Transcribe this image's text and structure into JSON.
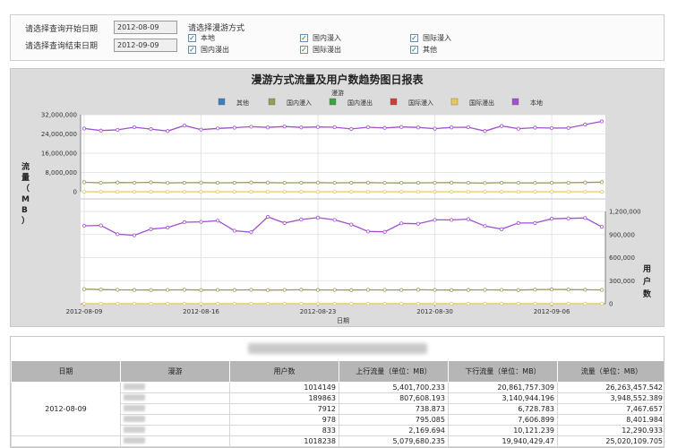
{
  "filter": {
    "start_label": "请选择查询开始日期",
    "end_label": "请选择查询结束日期",
    "start_value": "2012-08-09",
    "end_value": "2012-09-09",
    "roaming_label": "请选择漫游方式",
    "options": [
      {
        "label": "本地",
        "checked": true
      },
      {
        "label": "国内漫入",
        "checked": true
      },
      {
        "label": "国际漫入",
        "checked": true
      },
      {
        "label": "国内漫出",
        "checked": true
      },
      {
        "label": "国际漫出",
        "checked": true
      },
      {
        "label": "其他",
        "checked": true
      }
    ]
  },
  "chart": {
    "title": "漫游方式流量及用户数趋势图日报表",
    "legend_title": "漫游",
    "left_axis_label": "流量（MB）",
    "right_axis_label": "用户数",
    "x_axis_label": "日期"
  },
  "chart_data": {
    "type": "line",
    "x": [
      "2012-08-09",
      "2012-08-10",
      "2012-08-11",
      "2012-08-12",
      "2012-08-13",
      "2012-08-14",
      "2012-08-15",
      "2012-08-16",
      "2012-08-17",
      "2012-08-18",
      "2012-08-19",
      "2012-08-20",
      "2012-08-21",
      "2012-08-22",
      "2012-08-23",
      "2012-08-24",
      "2012-08-25",
      "2012-08-26",
      "2012-08-27",
      "2012-08-28",
      "2012-08-29",
      "2012-08-30",
      "2012-08-31",
      "2012-09-01",
      "2012-09-02",
      "2012-09-03",
      "2012-09-04",
      "2012-09-05",
      "2012-09-06",
      "2012-09-07",
      "2012-09-08",
      "2012-09-09"
    ],
    "x_ticks": [
      "2012-08-09",
      "2012-08-16",
      "2012-08-23",
      "2012-08-30",
      "2012-09-06"
    ],
    "top_ylim": [
      0,
      32000000
    ],
    "top_yticks": [
      "0",
      "8,000,000",
      "16,000,000",
      "24,000,000",
      "32,000,000"
    ],
    "bottom_ylim": [
      0,
      1200000
    ],
    "bottom_yticks": [
      "0",
      "300,000",
      "600,000",
      "900,000",
      "1,200,000"
    ],
    "legend": [
      {
        "name": "其他",
        "color": "#3a7fc1"
      },
      {
        "name": "国内漫入",
        "color": "#9a9a5a"
      },
      {
        "name": "国内漫出",
        "color": "#3aa33a"
      },
      {
        "name": "国际漫入",
        "color": "#d23a3a"
      },
      {
        "name": "国际漫出",
        "color": "#e8c95a"
      },
      {
        "name": "本地",
        "color": "#a24fd0"
      }
    ],
    "flow_series": [
      {
        "name": "本地",
        "color": "#a24fd0",
        "values": [
          26263457,
          25400000,
          25700000,
          26800000,
          26000000,
          25200000,
          27500000,
          25800000,
          26300000,
          26600000,
          27000000,
          26700000,
          27100000,
          26700000,
          26900000,
          26800000,
          26100000,
          26800000,
          26500000,
          26900000,
          26700000,
          26200000,
          26700000,
          26800000,
          25200000,
          27300000,
          26200000,
          26600000,
          26400000,
          26500000,
          27900000,
          29200000
        ]
      },
      {
        "name": "国内漫入",
        "color": "#9a9a5a",
        "values": [
          3948552,
          3700000,
          3850000,
          3750000,
          3900000,
          3650000,
          3750000,
          3800000,
          3700000,
          3750000,
          3850000,
          3800000,
          3700000,
          3750000,
          3800000,
          3700000,
          3750000,
          3800000,
          3700000,
          3650000,
          3700000,
          3750000,
          3800000,
          3700000,
          3600000,
          3750000,
          3700000,
          3650000,
          3700000,
          3750000,
          3850000,
          4000000
        ]
      },
      {
        "name": "国际漫出",
        "color": "#e8c95a",
        "values": [
          12290,
          12000,
          12500,
          12100,
          11900,
          12300,
          12200,
          12400,
          12100,
          12000,
          12300,
          12200,
          12100,
          12300,
          12200,
          12000,
          12100,
          12300,
          12200,
          12400,
          12100,
          12000,
          12300,
          12200,
          12100,
          12300,
          12200,
          12000,
          12100,
          12300,
          12200,
          12100
        ]
      }
    ],
    "user_series": [
      {
        "name": "本地",
        "color": "#a24fd0",
        "values": [
          1014149,
          1018238,
          905000,
          890000,
          970000,
          990000,
          1060000,
          1065000,
          1080000,
          950000,
          930000,
          1130000,
          1050000,
          1095000,
          1120000,
          1090000,
          1030000,
          940000,
          935000,
          1045000,
          1040000,
          1090000,
          1090000,
          1100000,
          1010000,
          970000,
          1050000,
          1050000,
          1105000,
          1110000,
          1115000,
          1000000
        ]
      },
      {
        "name": "国内漫入",
        "color": "#9a9a5a",
        "values": [
          189863,
          184000,
          181000,
          179000,
          178000,
          180000,
          182000,
          178000,
          180000,
          179000,
          181000,
          177000,
          180000,
          182000,
          179000,
          180000,
          178000,
          181000,
          180000,
          179000,
          182000,
          180000,
          178000,
          179000,
          181000,
          180000,
          178000,
          183000,
          186000,
          184000,
          182000,
          180000
        ]
      },
      {
        "name": "国际漫出",
        "color": "#e8c95a",
        "values": [
          833,
          820,
          810,
          840,
          830,
          825,
          835,
          830,
          820,
          815,
          830,
          840,
          835,
          830,
          825,
          820,
          830,
          835,
          840,
          830,
          825,
          820,
          830,
          835,
          840,
          830,
          825,
          830,
          835,
          840,
          830,
          825
        ]
      }
    ]
  },
  "table": {
    "headers": [
      "日期",
      "漫游",
      "用户数",
      "上行流量（单位：MB）",
      "下行流量（单位：MB）",
      "流量（单位：MB）"
    ],
    "rows": [
      {
        "date": "2012-08-09",
        "users": "1014149",
        "up": "5,401,700.233",
        "down": "20,861,757.309",
        "total": "26,263,457.542"
      },
      {
        "date": "",
        "users": "189863",
        "up": "807,608.193",
        "down": "3,140,944.196",
        "total": "3,948,552.389"
      },
      {
        "date": "",
        "users": "7912",
        "up": "738.873",
        "down": "6,728.783",
        "total": "7,467.657"
      },
      {
        "date": "",
        "users": "978",
        "up": "795.085",
        "down": "7,606.899",
        "total": "8,401.984"
      },
      {
        "date": "",
        "users": "833",
        "up": "2,169.694",
        "down": "10,121.239",
        "total": "12,290.933"
      },
      {
        "date": "",
        "users": "1018238",
        "up": "5,079,680.235",
        "down": "19,940,429.47",
        "total": "25,020,109.705"
      }
    ]
  }
}
